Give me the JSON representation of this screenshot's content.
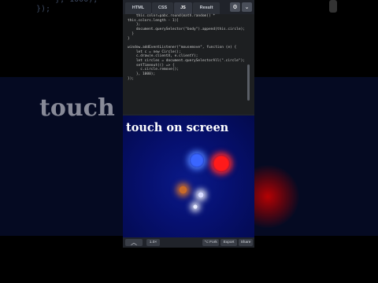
{
  "background": {
    "code_text": "    }, 1000);\n});",
    "big_text": "touch"
  },
  "tabs": [
    {
      "label": "HTML",
      "active": false
    },
    {
      "label": "CSS",
      "active": false
    },
    {
      "label": "JS",
      "active": true
    },
    {
      "label": "Result",
      "active": false
    }
  ],
  "toolbar": {
    "settings_icon": "gear-icon",
    "collapse_icon": "chevron-down-icon"
  },
  "code_lines": [
    "    this.color=pabc.round(math.random() *",
    "this.colors.length - 1)]",
    "    };",
    "    document.querySelector(\"body\").append(this.circle);",
    "  }",
    "}",
    "",
    "window.addEventListener(\"mousemove\", function (e) {",
    "    let c = new Circle();",
    "    c.draw(e.clientX, e.clientY);",
    "    let circles = document.querySelectorAll(\".circle\");",
    "    setTimeout(() => {",
    "      c.circle.remove();",
    "    }, 1000);",
    "});"
  ],
  "result": {
    "title": "touch on screen",
    "circles": [
      {
        "color": "#ff1a1a",
        "glow": "#ff2a2a"
      },
      {
        "color": "#3a66ff",
        "glow": "#5080ff"
      },
      {
        "color": "#c86a2a",
        "glow": "#d07030"
      },
      {
        "color": "#d8dcff",
        "glow": "#ffffff"
      },
      {
        "color": "#e8ecff",
        "glow": "#ffffff"
      }
    ]
  },
  "bottom_bar": {
    "zoom": "1.0×",
    "fork": "⌥ Fork",
    "export": "Export",
    "share": "Share"
  },
  "colors": {
    "accent": "#343842",
    "result_bg": "#061070"
  }
}
